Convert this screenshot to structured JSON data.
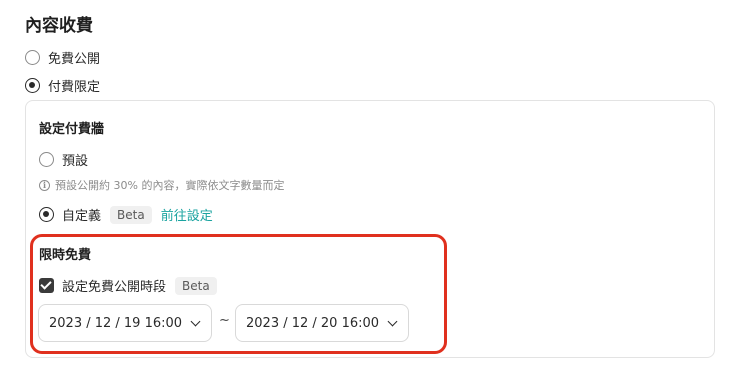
{
  "section": {
    "title": "內容收費"
  },
  "visibility": {
    "free_label": "免費公開",
    "paid_label": "付費限定"
  },
  "paywall": {
    "title": "設定付費牆",
    "default_label": "預設",
    "default_hint": "預設公開約 30% 的內容，實際依文字數量而定",
    "custom_label": "自定義",
    "custom_badge": "Beta",
    "custom_link": "前往設定"
  },
  "limited_free": {
    "title": "限時免費",
    "checkbox_label": "設定免費公開時段",
    "checkbox_badge": "Beta",
    "checkbox_checked": true,
    "start": "2023 / 12 / 19 16:00",
    "separator": "~",
    "end": "2023 / 12 / 20 16:00"
  },
  "colors": {
    "accent_link": "#1aa3a0",
    "highlight_border": "#e0301e"
  }
}
